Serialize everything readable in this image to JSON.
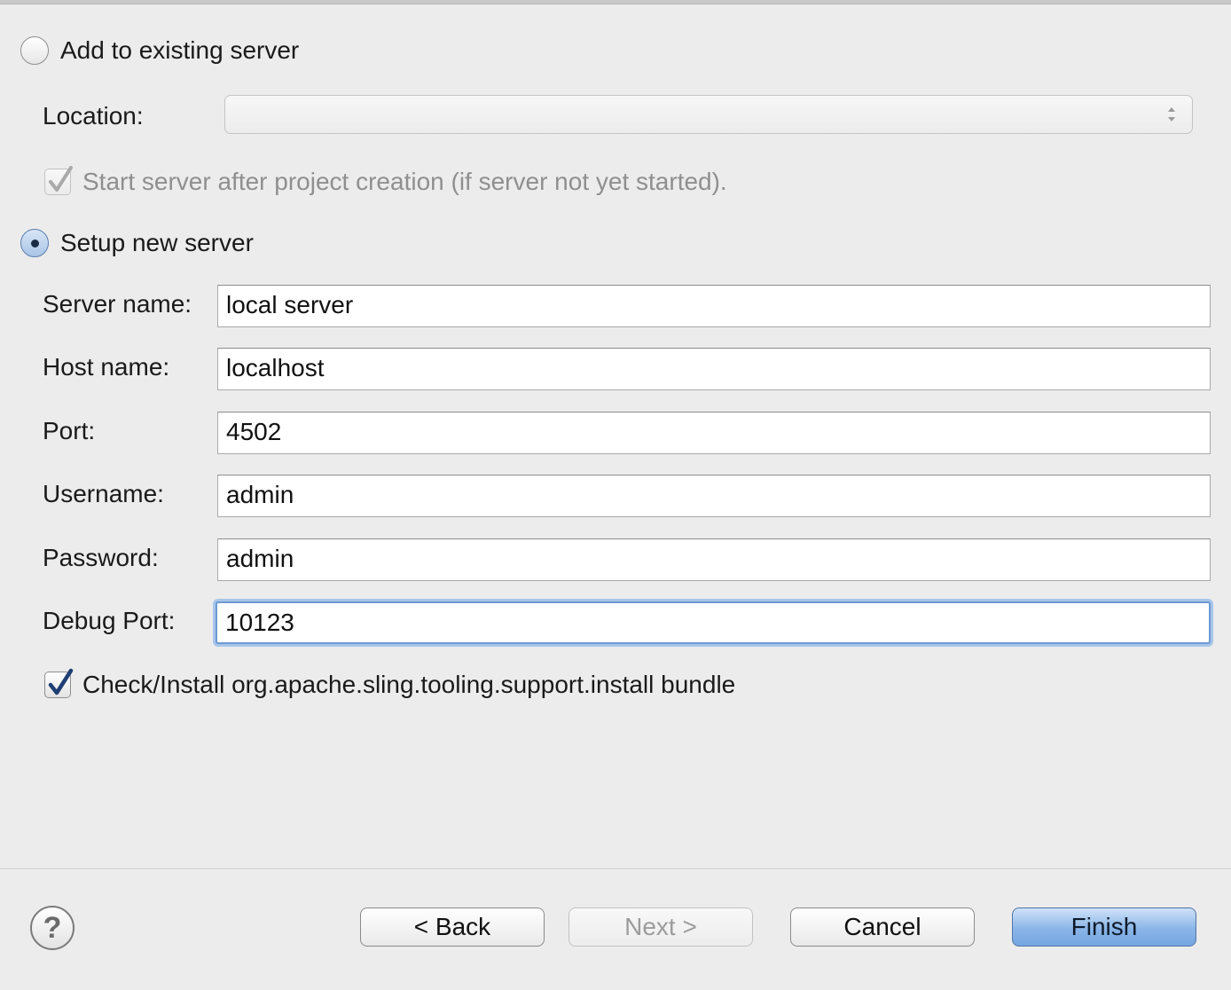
{
  "existing_server": {
    "radio_label": "Add to existing server",
    "location_label": "Location:",
    "location_value": "",
    "start_server_label": "Start server after project creation (if server not yet started)."
  },
  "new_server": {
    "radio_label": "Setup new server",
    "fields": [
      {
        "label": "Server name:",
        "value": "local server"
      },
      {
        "label": "Host name:",
        "value": "localhost"
      },
      {
        "label": "Port:",
        "value": "4502"
      },
      {
        "label": "Username:",
        "value": "admin"
      },
      {
        "label": "Password:",
        "value": "admin"
      },
      {
        "label": "Debug Port:",
        "value": "10123"
      }
    ],
    "install_bundle_label": "Check/Install org.apache.sling.tooling.support.install bundle"
  },
  "footer": {
    "help_icon": "?",
    "back_label": "< Back",
    "next_label": "Next >",
    "cancel_label": "Cancel",
    "finish_label": "Finish"
  }
}
